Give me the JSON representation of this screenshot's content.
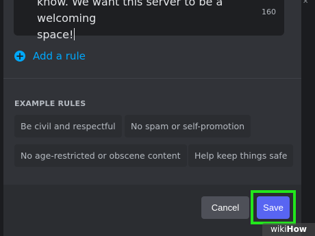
{
  "rule_editor": {
    "text_line1": "know. We want this server to be a welcoming",
    "text_line2": "space!",
    "char_count": "160"
  },
  "add_rule_label": "Add a rule",
  "example_rules": {
    "title": "EXAMPLE RULES",
    "chips": [
      "Be civil and respectful",
      "No spam or self-promotion",
      "No age-restricted or obscene content",
      "Help keep things safe"
    ]
  },
  "footer": {
    "cancel_label": "Cancel",
    "save_label": "Save"
  },
  "watermark": {
    "part1": "wiki",
    "part2": "How"
  },
  "colors": {
    "accent_link": "#00a8fc",
    "save_button": "#5865f2",
    "highlight": "#22e61c",
    "modal_bg": "#313338"
  }
}
